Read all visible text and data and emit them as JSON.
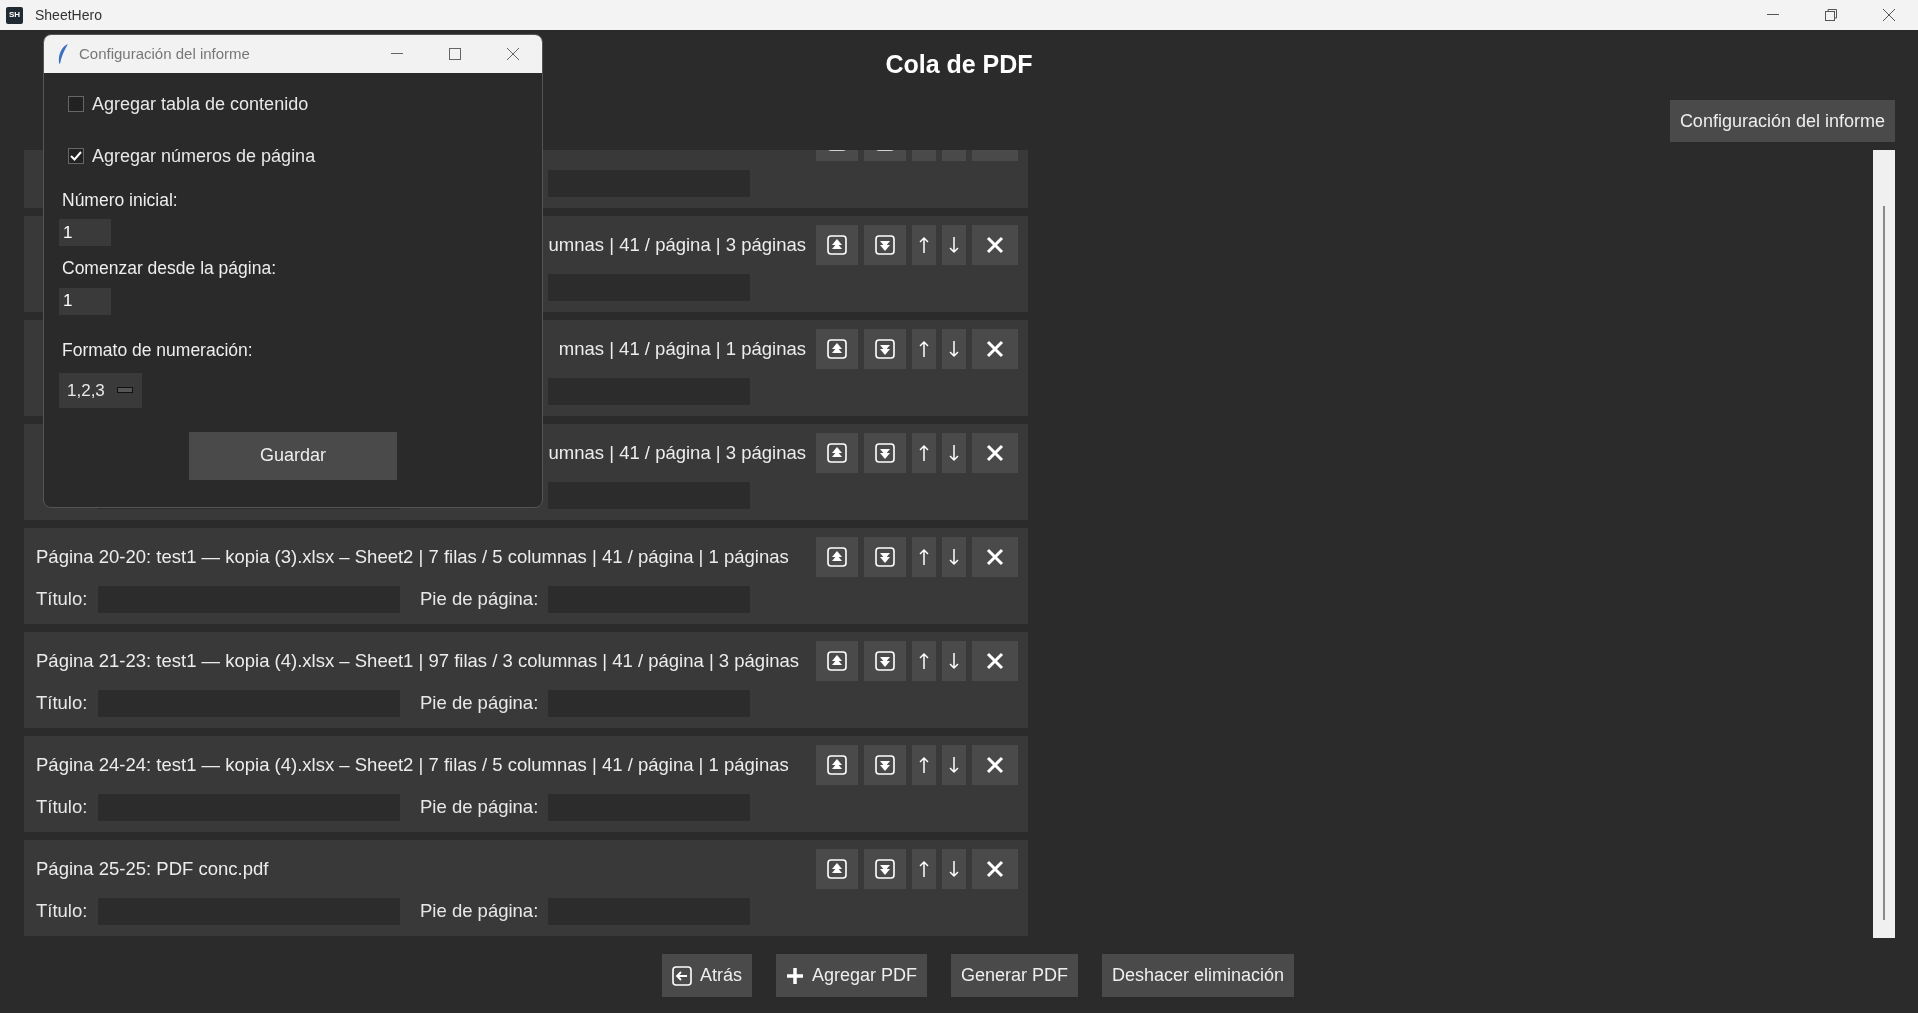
{
  "window": {
    "badge": "SH",
    "title": "SheetHero"
  },
  "heading": "Cola de PDF",
  "report_settings_button": "Configuración del informe",
  "queue": [
    {
      "kind": "clipped"
    },
    {
      "description_end": "umnas | 41 / página | 3 páginas"
    },
    {
      "description_end": "mnas | 41 / página | 1 páginas"
    },
    {
      "description_end": "umnas | 41 / página | 3 páginas"
    },
    {
      "description": "Página 20-20: test1 — kopia (3).xlsx – Sheet2 | 7 filas / 5 columnas | 41 / página | 1 páginas",
      "title_label": "Título:",
      "footer_label": "Pie de página:"
    },
    {
      "description": "Página 21-23: test1 — kopia (4).xlsx – Sheet1 | 97 filas / 3 columnas | 41 / página | 3 páginas",
      "title_label": "Título:",
      "footer_label": "Pie de página:"
    },
    {
      "description": "Página 24-24: test1 — kopia (4).xlsx – Sheet2 | 7 filas / 5 columnas | 41 / página | 1 páginas",
      "title_label": "Título:",
      "footer_label": "Pie de página:"
    },
    {
      "description": "Página 25-25: PDF conc.pdf",
      "title_label": "Título:",
      "footer_label": "Pie de página:"
    }
  ],
  "bottom_buttons": [
    {
      "label": "Atrás",
      "kind": "back"
    },
    {
      "label": "Agregar PDF",
      "kind": "add"
    },
    {
      "label": "Generar PDF",
      "kind": "plain"
    },
    {
      "label": "Deshacer eliminación",
      "kind": "plain"
    }
  ],
  "dialog": {
    "title": "Configuración del informe",
    "options": [
      {
        "label": "Agregar tabla de contenido",
        "checked": false
      },
      {
        "label": "Agregar números de página",
        "checked": true
      }
    ],
    "fields": [
      {
        "label": "Número inicial:",
        "value": "1"
      },
      {
        "label": "Comenzar desde la página:",
        "value": "1"
      }
    ],
    "format": {
      "label": "Formato de numeración:",
      "value": "1,2,3"
    },
    "save_button": "Guardar"
  }
}
